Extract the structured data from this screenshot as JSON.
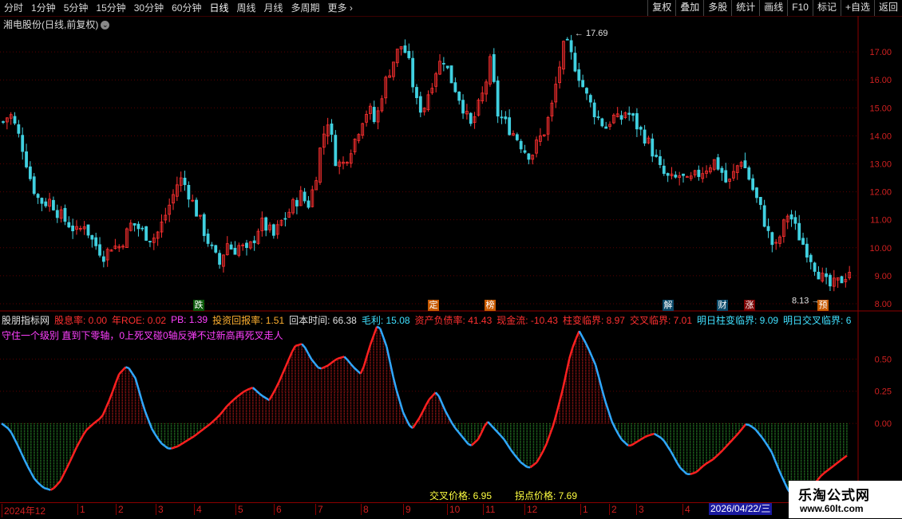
{
  "toolbar": {
    "periods": [
      "分时",
      "1分钟",
      "5分钟",
      "15分钟",
      "30分钟",
      "60分钟",
      "日线",
      "周线",
      "月线",
      "多周期",
      "更多"
    ],
    "active_period": "日线",
    "buttons": [
      "复权",
      "叠加",
      "多股",
      "统计",
      "画线",
      "F10",
      "标记",
      "+自选",
      "返回"
    ]
  },
  "main_title": "湘电股份(日线,前复权)",
  "indicator": {
    "name": "股朋指标网",
    "fields": [
      {
        "text": "股息率: 0.00",
        "color": "#ff3030"
      },
      {
        "text": "年ROE: 0.02",
        "color": "#ff3030"
      },
      {
        "text": "PB: 1.39",
        "color": "#ff40ff"
      },
      {
        "text": "投资回报率: 1.51",
        "color": "#ffb030"
      },
      {
        "text": "回本时间: 66.38",
        "color": "#e0e0e0"
      },
      {
        "text": "毛利: 15.08",
        "color": "#40e0ff"
      },
      {
        "text": "资产负债率: 41.43",
        "color": "#ff3030"
      },
      {
        "text": "现金流: -10.43",
        "color": "#ff3030"
      },
      {
        "text": "柱变临界: 8.97",
        "color": "#ff3030"
      },
      {
        "text": "交叉临界: 7.01",
        "color": "#ff3030"
      },
      {
        "text": "明日柱变临界: 9.09",
        "color": "#40e0ff"
      },
      {
        "text": "明日交叉临界: 6",
        "color": "#40e0ff"
      }
    ],
    "subtitle": "守住一个级别 直到下零轴，0上死叉碰0轴反弹不过新高再死叉走人",
    "cross_price": "交叉价格: 6.95",
    "turn_price": "拐点价格: 7.69"
  },
  "badges": [
    {
      "text": "跌",
      "bg": "#0a5a0a",
      "color": "#ffffff"
    },
    {
      "text": "定",
      "bg": "#c85a00",
      "color": "#ffffff"
    },
    {
      "text": "榜",
      "bg": "#c85a00",
      "color": "#ffffff"
    },
    {
      "text": "解",
      "bg": "#0a4a6a",
      "color": "#ffffff"
    },
    {
      "text": "财",
      "bg": "#0a4a6a",
      "color": "#ffffff"
    },
    {
      "text": "涨",
      "bg": "#7a0000",
      "color": "#ffffff"
    },
    {
      "text": "预",
      "bg": "#c85a00",
      "color": "#ffffff"
    }
  ],
  "date_axis": {
    "labels": [
      "2024年12",
      "1",
      "2",
      "3",
      "4",
      "5",
      "6",
      "7",
      "8",
      "9",
      "10",
      "11",
      "12",
      "1",
      "2",
      "3",
      "4"
    ],
    "current_date": "2026/04/22/三"
  },
  "logo": {
    "line1": "乐淘公式网",
    "line2": "www.60lt.com"
  },
  "chart_data": [
    {
      "type": "candlestick",
      "title": "湘电股份(日线,前复权)",
      "ylim": [
        7.8,
        18.0
      ],
      "y_ticks": [
        "8.00",
        "9.00",
        "10.00",
        "11.00",
        "12.00",
        "13.00",
        "14.00",
        "15.00",
        "16.00",
        "17.00"
      ],
      "high_label": "17.69",
      "low_label": "8.13",
      "close_path": [
        14.5,
        14.8,
        14.2,
        13.5,
        12.5,
        11.8,
        11.6,
        11.7,
        11.3,
        11.0,
        10.8,
        10.5,
        10.9,
        10.3,
        10.0,
        9.7,
        10.1,
        10.0,
        10.4,
        10.9,
        10.7,
        10.5,
        10.3,
        10.6,
        11.2,
        11.8,
        12.5,
        12.2,
        11.6,
        11.0,
        10.4,
        9.8,
        9.4,
        10.2,
        9.9,
        10.1,
        9.8,
        10.3,
        10.9,
        10.7,
        10.4,
        10.9,
        11.2,
        11.6,
        11.9,
        11.5,
        12.3,
        13.8,
        14.6,
        13.2,
        12.9,
        13.4,
        13.9,
        14.6,
        15.0,
        14.4,
        15.6,
        16.3,
        16.9,
        17.3,
        16.5,
        15.2,
        14.9,
        15.7,
        16.4,
        16.8,
        16.1,
        15.6,
        15.0,
        14.3,
        14.9,
        15.6,
        16.7,
        14.8,
        14.5,
        14.2,
        13.9,
        13.5,
        13.3,
        13.8,
        14.2,
        15.0,
        16.3,
        17.4,
        16.8,
        16.2,
        15.5,
        15.0,
        14.6,
        14.3,
        14.7,
        14.5,
        14.9,
        14.6,
        14.2,
        13.9,
        13.4,
        12.8,
        12.5,
        12.4,
        12.6,
        12.3,
        12.5,
        12.7,
        12.9,
        13.1,
        12.8,
        12.2,
        12.7,
        13.2,
        12.6,
        11.9,
        11.3,
        10.5,
        9.9,
        10.6,
        11.3,
        10.7,
        10.2,
        9.8,
        9.3,
        8.9,
        8.6,
        8.7,
        8.9,
        9.2
      ]
    },
    {
      "type": "histogram",
      "title": "股朋指标网",
      "ylim": [
        -0.6,
        0.75
      ],
      "y_ticks": [
        "0.00",
        "0.25",
        "0.50"
      ],
      "values": [
        0.0,
        -0.05,
        -0.18,
        -0.32,
        -0.44,
        -0.5,
        -0.52,
        -0.45,
        -0.32,
        -0.18,
        -0.06,
        0.0,
        0.05,
        0.2,
        0.38,
        0.45,
        0.35,
        0.12,
        -0.05,
        -0.15,
        -0.2,
        -0.18,
        -0.14,
        -0.1,
        -0.05,
        0.0,
        0.06,
        0.14,
        0.2,
        0.25,
        0.28,
        0.22,
        0.18,
        0.3,
        0.45,
        0.6,
        0.62,
        0.5,
        0.42,
        0.45,
        0.5,
        0.52,
        0.44,
        0.38,
        0.6,
        0.78,
        0.6,
        0.3,
        0.08,
        -0.05,
        0.05,
        0.18,
        0.25,
        0.1,
        -0.02,
        -0.1,
        -0.18,
        -0.12,
        0.02,
        -0.05,
        -0.12,
        -0.22,
        -0.3,
        -0.35,
        -0.3,
        -0.18,
        0.0,
        0.25,
        0.55,
        0.72,
        0.6,
        0.45,
        0.2,
        0.0,
        -0.12,
        -0.18,
        -0.14,
        -0.1,
        -0.08,
        -0.12,
        -0.22,
        -0.34,
        -0.4,
        -0.38,
        -0.32,
        -0.28,
        -0.22,
        -0.15,
        -0.08,
        0.0,
        -0.04,
        -0.12,
        -0.22,
        -0.38,
        -0.52,
        -0.6,
        -0.55,
        -0.48,
        -0.4,
        -0.35,
        -0.3,
        -0.25
      ],
      "colors": {
        "positive": "#b01818",
        "negative": "#2a8a2a",
        "line_up": "#ff2020",
        "line_down": "#30a8ff"
      }
    }
  ]
}
